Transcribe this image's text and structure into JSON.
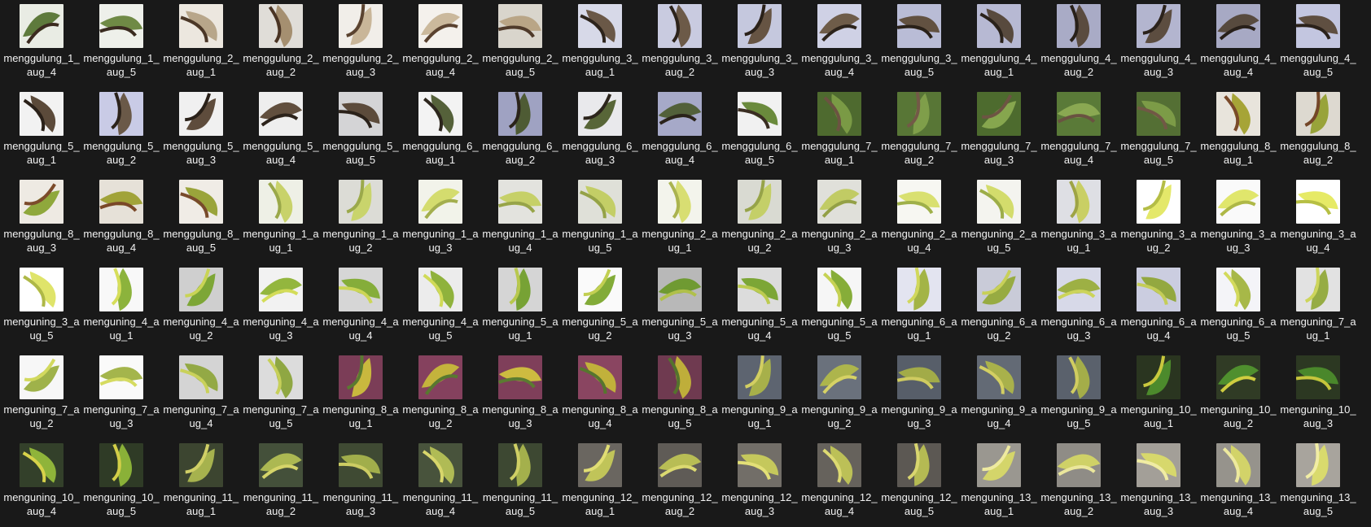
{
  "files": [
    {
      "name": "menggulung_1_aug_4",
      "thumb": {
        "bg": "#e9ece4",
        "leaf": "#5e7a3c",
        "accent": "#3b2a1f"
      }
    },
    {
      "name": "menggulung_1_aug_5",
      "thumb": {
        "bg": "#eef0ea",
        "leaf": "#6f8a45",
        "accent": "#3a2b20"
      }
    },
    {
      "name": "menggulung_2_aug_1",
      "thumb": {
        "bg": "#ece7df",
        "leaf": "#b8a68a",
        "accent": "#4b3727"
      }
    },
    {
      "name": "menggulung_2_aug_2",
      "thumb": {
        "bg": "#e0ddd8",
        "leaf": "#a58f70",
        "accent": "#4a3424"
      }
    },
    {
      "name": "menggulung_2_aug_3",
      "thumb": {
        "bg": "#f1eee9",
        "leaf": "#c9b699",
        "accent": "#5b4330"
      }
    },
    {
      "name": "menggulung_2_aug_4",
      "thumb": {
        "bg": "#f4f1ec",
        "leaf": "#cbb99c",
        "accent": "#5a422f"
      }
    },
    {
      "name": "menggulung_2_aug_5",
      "thumb": {
        "bg": "#d9d5cc",
        "leaf": "#b9a586",
        "accent": "#4f3a2a"
      }
    },
    {
      "name": "menggulung_3_aug_1",
      "thumb": {
        "bg": "#d7d9e8",
        "leaf": "#6a5847",
        "accent": "#2d241c"
      }
    },
    {
      "name": "menggulung_3_aug_2",
      "thumb": {
        "bg": "#c9cbe0",
        "leaf": "#6c5a48",
        "accent": "#2c231b"
      }
    },
    {
      "name": "menggulung_3_aug_3",
      "thumb": {
        "bg": "#c5c8de",
        "leaf": "#665443",
        "accent": "#2a2119"
      }
    },
    {
      "name": "menggulung_3_aug_4",
      "thumb": {
        "bg": "#cfd1e5",
        "leaf": "#6e5c49",
        "accent": "#2c231b"
      }
    },
    {
      "name": "menggulung_3_aug_5",
      "thumb": {
        "bg": "#b9bcd6",
        "leaf": "#625141",
        "accent": "#2a2119"
      }
    },
    {
      "name": "menggulung_4_aug_1",
      "thumb": {
        "bg": "#b7b9d3",
        "leaf": "#584a3e",
        "accent": "#2a221b"
      }
    },
    {
      "name": "menggulung_4_aug_2",
      "thumb": {
        "bg": "#a9abc6",
        "leaf": "#5a4b3f",
        "accent": "#29211a"
      }
    },
    {
      "name": "menggulung_4_aug_3",
      "thumb": {
        "bg": "#b3b5cf",
        "leaf": "#5c4d40",
        "accent": "#2b221b"
      }
    },
    {
      "name": "menggulung_4_aug_4",
      "thumb": {
        "bg": "#a7a9c4",
        "leaf": "#574a3e",
        "accent": "#28201a"
      }
    },
    {
      "name": "menggulung_4_aug_5",
      "thumb": {
        "bg": "#c3c6e0",
        "leaf": "#5f4f41",
        "accent": "#2b221b"
      }
    },
    {
      "name": "menggulung_5_aug_1",
      "thumb": {
        "bg": "#f2f2f2",
        "leaf": "#5b4a3a",
        "accent": "#2a2119"
      }
    },
    {
      "name": "menggulung_5_aug_2",
      "thumb": {
        "bg": "#c9cbe6",
        "leaf": "#6a5948",
        "accent": "#2c231b"
      }
    },
    {
      "name": "menggulung_5_aug_3",
      "thumb": {
        "bg": "#f0f0f0",
        "leaf": "#5e4c3c",
        "accent": "#2a2119"
      }
    },
    {
      "name": "menggulung_5_aug_4",
      "thumb": {
        "bg": "#eeeeee",
        "leaf": "#614f3e",
        "accent": "#2b221a"
      }
    },
    {
      "name": "menggulung_5_aug_5",
      "thumb": {
        "bg": "#d4d4d6",
        "leaf": "#5c4b3b",
        "accent": "#2a2119"
      }
    },
    {
      "name": "menggulung_6_aug_1",
      "thumb": {
        "bg": "#f3f3f3",
        "leaf": "#55613a",
        "accent": "#2d261d"
      }
    },
    {
      "name": "menggulung_6_aug_2",
      "thumb": {
        "bg": "#9fa2c2",
        "leaf": "#4e5b34",
        "accent": "#2a231a"
      }
    },
    {
      "name": "menggulung_6_aug_3",
      "thumb": {
        "bg": "#e9e9ec",
        "leaf": "#586638",
        "accent": "#2c251c"
      }
    },
    {
      "name": "menggulung_6_aug_4",
      "thumb": {
        "bg": "#a6a9c8",
        "leaf": "#52603a",
        "accent": "#2a231a"
      }
    },
    {
      "name": "menggulung_6_aug_5",
      "thumb": {
        "bg": "#f1f1f1",
        "leaf": "#6a8a3c",
        "accent": "#3a2e22"
      }
    },
    {
      "name": "menggulung_7_aug_1",
      "thumb": {
        "bg": "#4e6a2f",
        "leaf": "#7a9a45",
        "accent": "#6b5341"
      }
    },
    {
      "name": "menggulung_7_aug_2",
      "thumb": {
        "bg": "#587636",
        "leaf": "#7f9e4a",
        "accent": "#735947"
      }
    },
    {
      "name": "menggulung_7_aug_3",
      "thumb": {
        "bg": "#4d6b2e",
        "leaf": "#86a64e",
        "accent": "#6d5443"
      }
    },
    {
      "name": "menggulung_7_aug_4",
      "thumb": {
        "bg": "#5a7a38",
        "leaf": "#8aa852",
        "accent": "#6a5241"
      }
    },
    {
      "name": "menggulung_7_aug_5",
      "thumb": {
        "bg": "#546f34",
        "leaf": "#7c9b47",
        "accent": "#715845"
      }
    },
    {
      "name": "menggulung_8_aug_1",
      "thumb": {
        "bg": "#e8e4dc",
        "leaf": "#a6a437",
        "accent": "#7a4a2a"
      }
    },
    {
      "name": "menggulung_8_aug_2",
      "thumb": {
        "bg": "#ddd9d0",
        "leaf": "#98a33a",
        "accent": "#744628"
      }
    },
    {
      "name": "menggulung_8_aug_3",
      "thumb": {
        "bg": "#eeeae3",
        "leaf": "#8fa83c",
        "accent": "#7c4b2b"
      }
    },
    {
      "name": "menggulung_8_aug_4",
      "thumb": {
        "bg": "#e6e1d8",
        "leaf": "#a1a339",
        "accent": "#7a4828"
      }
    },
    {
      "name": "menggulung_8_aug_5",
      "thumb": {
        "bg": "#f0ece6",
        "leaf": "#9aa43b",
        "accent": "#784a2b"
      }
    },
    {
      "name": "menguning_1_aug_1",
      "thumb": {
        "bg": "#eef0e6",
        "leaf": "#c8d26a",
        "accent": "#9aa84a"
      }
    },
    {
      "name": "menguning_1_aug_2",
      "thumb": {
        "bg": "#dcdcd6",
        "leaf": "#c9d46c",
        "accent": "#9ba94b"
      }
    },
    {
      "name": "menguning_1_aug_3",
      "thumb": {
        "bg": "#f2f3ea",
        "leaf": "#d4dc6e",
        "accent": "#a3ae4e"
      }
    },
    {
      "name": "menguning_1_aug_4",
      "thumb": {
        "bg": "#e3e3de",
        "leaf": "#c6d068",
        "accent": "#97a448"
      }
    },
    {
      "name": "menguning_1_aug_5",
      "thumb": {
        "bg": "#dfe0d8",
        "leaf": "#c3ce66",
        "accent": "#94a247"
      }
    },
    {
      "name": "menguning_2_aug_1",
      "thumb": {
        "bg": "#f3f4ec",
        "leaf": "#d8de72",
        "accent": "#aab350"
      }
    },
    {
      "name": "menguning_2_aug_2",
      "thumb": {
        "bg": "#d9dad2",
        "leaf": "#c4cf68",
        "accent": "#96a349"
      }
    },
    {
      "name": "menguning_2_aug_3",
      "thumb": {
        "bg": "#e0e0da",
        "leaf": "#c1cb64",
        "accent": "#93a046"
      }
    },
    {
      "name": "menguning_2_aug_4",
      "thumb": {
        "bg": "#f7f7f2",
        "leaf": "#d9e070",
        "accent": "#9fb04a"
      }
    },
    {
      "name": "menguning_2_aug_5",
      "thumb": {
        "bg": "#f4f4ef",
        "leaf": "#d3dc6c",
        "accent": "#9cad49"
      }
    },
    {
      "name": "menguning_3_aug_1",
      "thumb": {
        "bg": "#dedfe4",
        "leaf": "#c9cf64",
        "accent": "#9ea445"
      }
    },
    {
      "name": "menguning_3_aug_2",
      "thumb": {
        "bg": "#ffffff",
        "leaf": "#e4e86a",
        "accent": "#b4bd46"
      }
    },
    {
      "name": "menguning_3_aug_3",
      "thumb": {
        "bg": "#fafafa",
        "leaf": "#e0e66c",
        "accent": "#aeb847"
      }
    },
    {
      "name": "menguning_3_aug_4",
      "thumb": {
        "bg": "#ffffff",
        "leaf": "#e6ea66",
        "accent": "#b6bf44"
      }
    },
    {
      "name": "menguning_3_aug_5",
      "thumb": {
        "bg": "#ffffff",
        "leaf": "#dfe46a",
        "accent": "#aeb847"
      }
    },
    {
      "name": "menguning_4_aug_1",
      "thumb": {
        "bg": "#f8f8f8",
        "leaf": "#8cb33c",
        "accent": "#d6de5a"
      }
    },
    {
      "name": "menguning_4_aug_2",
      "thumb": {
        "bg": "#cfcfcf",
        "leaf": "#7da636",
        "accent": "#c9d455"
      }
    },
    {
      "name": "menguning_4_aug_3",
      "thumb": {
        "bg": "#f2f2f2",
        "leaf": "#93b63e",
        "accent": "#d3dc58"
      }
    },
    {
      "name": "menguning_4_aug_4",
      "thumb": {
        "bg": "#d6d6d6",
        "leaf": "#85ad3a",
        "accent": "#ccd656"
      }
    },
    {
      "name": "menguning_4_aug_5",
      "thumb": {
        "bg": "#ececec",
        "leaf": "#8fb23c",
        "accent": "#d0da57"
      }
    },
    {
      "name": "menguning_5_aug_1",
      "thumb": {
        "bg": "#d5d5d5",
        "leaf": "#77a235",
        "accent": "#b8c84e"
      }
    },
    {
      "name": "menguning_5_aug_2",
      "thumb": {
        "bg": "#fafafa",
        "leaf": "#82ab38",
        "accent": "#c2cf52"
      }
    },
    {
      "name": "menguning_5_aug_3",
      "thumb": {
        "bg": "#b8b8b8",
        "leaf": "#6f9a32",
        "accent": "#b0c04a"
      }
    },
    {
      "name": "menguning_5_aug_4",
      "thumb": {
        "bg": "#dcdcdc",
        "leaf": "#7ca636",
        "accent": "#bccb50"
      }
    },
    {
      "name": "menguning_5_aug_5",
      "thumb": {
        "bg": "#f6f6f6",
        "leaf": "#86ad39",
        "accent": "#c6d254"
      }
    },
    {
      "name": "menguning_6_aug_1",
      "thumb": {
        "bg": "#e3e4f0",
        "leaf": "#a3b446",
        "accent": "#d1d85c"
      }
    },
    {
      "name": "menguning_6_aug_2",
      "thumb": {
        "bg": "#c9cbd8",
        "leaf": "#97ab42",
        "accent": "#c8d059"
      }
    },
    {
      "name": "menguning_6_aug_3",
      "thumb": {
        "bg": "#d7d9e8",
        "leaf": "#9db044",
        "accent": "#ccd45a"
      }
    },
    {
      "name": "menguning_6_aug_4",
      "thumb": {
        "bg": "#cbcde0",
        "leaf": "#93a840",
        "accent": "#c4cd57"
      }
    },
    {
      "name": "menguning_6_aug_5",
      "thumb": {
        "bg": "#f4f4f8",
        "leaf": "#a7b848",
        "accent": "#d3da5d"
      }
    },
    {
      "name": "menguning_7_aug_1",
      "thumb": {
        "bg": "#e2e2e2",
        "leaf": "#96ac44",
        "accent": "#cdd55b"
      }
    },
    {
      "name": "menguning_7_aug_2",
      "thumb": {
        "bg": "#f7f7f7",
        "leaf": "#9fb24a",
        "accent": "#d2d95e"
      }
    },
    {
      "name": "menguning_7_aug_3",
      "thumb": {
        "bg": "#fafafa",
        "leaf": "#a4b54c",
        "accent": "#d5db60"
      }
    },
    {
      "name": "menguning_7_aug_4",
      "thumb": {
        "bg": "#d4d4d4",
        "leaf": "#93a945",
        "accent": "#c9d15a"
      }
    },
    {
      "name": "menguning_7_aug_5",
      "thumb": {
        "bg": "#dcdcdc",
        "leaf": "#8fa743",
        "accent": "#c6cf59"
      }
    },
    {
      "name": "menguning_8_aug_1",
      "thumb": {
        "bg": "#7b3d57",
        "leaf": "#c9b83e",
        "accent": "#5a7a30"
      }
    },
    {
      "name": "menguning_8_aug_2",
      "thumb": {
        "bg": "#85415e",
        "leaf": "#c4b33c",
        "accent": "#58782f"
      }
    },
    {
      "name": "menguning_8_aug_3",
      "thumb": {
        "bg": "#7f3f5a",
        "leaf": "#cdbb40",
        "accent": "#5b7b31"
      }
    },
    {
      "name": "menguning_8_aug_4",
      "thumb": {
        "bg": "#8a4561",
        "leaf": "#c1b13b",
        "accent": "#56762e"
      }
    },
    {
      "name": "menguning_8_aug_5",
      "thumb": {
        "bg": "#6f3a50",
        "leaf": "#bfae3a",
        "accent": "#54732d"
      }
    },
    {
      "name": "menguning_9_aug_1",
      "thumb": {
        "bg": "#5d6470",
        "leaf": "#a7b04a",
        "accent": "#d2ce62"
      }
    },
    {
      "name": "menguning_9_aug_2",
      "thumb": {
        "bg": "#6a717c",
        "leaf": "#adb54c",
        "accent": "#d6d265"
      }
    },
    {
      "name": "menguning_9_aug_3",
      "thumb": {
        "bg": "#575e69",
        "leaf": "#a2ab48",
        "accent": "#cfcb60"
      }
    },
    {
      "name": "menguning_9_aug_4",
      "thumb": {
        "bg": "#636a75",
        "leaf": "#a9b14b",
        "accent": "#d3cf63"
      }
    },
    {
      "name": "menguning_9_aug_5",
      "thumb": {
        "bg": "#5a616c",
        "leaf": "#a4ad49",
        "accent": "#d0cc61"
      }
    },
    {
      "name": "menguning_10_aug_1",
      "thumb": {
        "bg": "#2a3520",
        "leaf": "#4c8a2c",
        "accent": "#c9c83e"
      }
    },
    {
      "name": "menguning_10_aug_2",
      "thumb": {
        "bg": "#303b25",
        "leaf": "#4f8f2e",
        "accent": "#cfcd40"
      }
    },
    {
      "name": "menguning_10_aug_3",
      "thumb": {
        "bg": "#2c3822",
        "leaf": "#4a872b",
        "accent": "#c6c53c"
      }
    },
    {
      "name": "menguning_10_aug_4",
      "thumb": {
        "bg": "#33402a",
        "leaf": "#8fb43a",
        "accent": "#d7d24a"
      }
    },
    {
      "name": "menguning_10_aug_5",
      "thumb": {
        "bg": "#2f3b26",
        "leaf": "#8ab138",
        "accent": "#d3ce48"
      }
    },
    {
      "name": "menguning_11_aug_1",
      "thumb": {
        "bg": "#3c4530",
        "leaf": "#a6b24e",
        "accent": "#d0cf66"
      }
    },
    {
      "name": "menguning_11_aug_2",
      "thumb": {
        "bg": "#44503a",
        "leaf": "#acb852",
        "accent": "#d5d469"
      }
    },
    {
      "name": "menguning_11_aug_3",
      "thumb": {
        "bg": "#3f4a33",
        "leaf": "#a1ae4b",
        "accent": "#cccc63"
      }
    },
    {
      "name": "menguning_11_aug_4",
      "thumb": {
        "bg": "#48533c",
        "leaf": "#b0bb55",
        "accent": "#d8d66b"
      }
    },
    {
      "name": "menguning_11_aug_5",
      "thumb": {
        "bg": "#3d4832",
        "leaf": "#a4b04c",
        "accent": "#cfcf65"
      }
    },
    {
      "name": "menguning_12_aug_1",
      "thumb": {
        "bg": "#6a6660",
        "leaf": "#c0c459",
        "accent": "#e0dd74"
      }
    },
    {
      "name": "menguning_12_aug_2",
      "thumb": {
        "bg": "#5f5b56",
        "leaf": "#b8bd55",
        "accent": "#dbd970"
      }
    },
    {
      "name": "menguning_12_aug_3",
      "thumb": {
        "bg": "#726e68",
        "leaf": "#c5c85c",
        "accent": "#e3e077"
      }
    },
    {
      "name": "menguning_12_aug_4",
      "thumb": {
        "bg": "#66625c",
        "leaf": "#bcc057",
        "accent": "#ddda72"
      }
    },
    {
      "name": "menguning_12_aug_5",
      "thumb": {
        "bg": "#5c5853",
        "leaf": "#b5ba53",
        "accent": "#d9d66f"
      }
    },
    {
      "name": "menguning_13_aug_1",
      "thumb": {
        "bg": "#9a9790",
        "leaf": "#d4d56a",
        "accent": "#eeeaa0"
      }
    },
    {
      "name": "menguning_13_aug_2",
      "thumb": {
        "bg": "#8f8c86",
        "leaf": "#cfd167",
        "accent": "#ebe79c"
      }
    },
    {
      "name": "menguning_13_aug_3",
      "thumb": {
        "bg": "#a39f98",
        "leaf": "#d7d86c",
        "accent": "#f0eca3"
      }
    },
    {
      "name": "menguning_13_aug_4",
      "thumb": {
        "bg": "#96938c",
        "leaf": "#d2d369",
        "accent": "#ede99e"
      }
    },
    {
      "name": "menguning_13_aug_5",
      "thumb": {
        "bg": "#a8a49d",
        "leaf": "#d9da6d",
        "accent": "#f1eda5"
      }
    }
  ]
}
